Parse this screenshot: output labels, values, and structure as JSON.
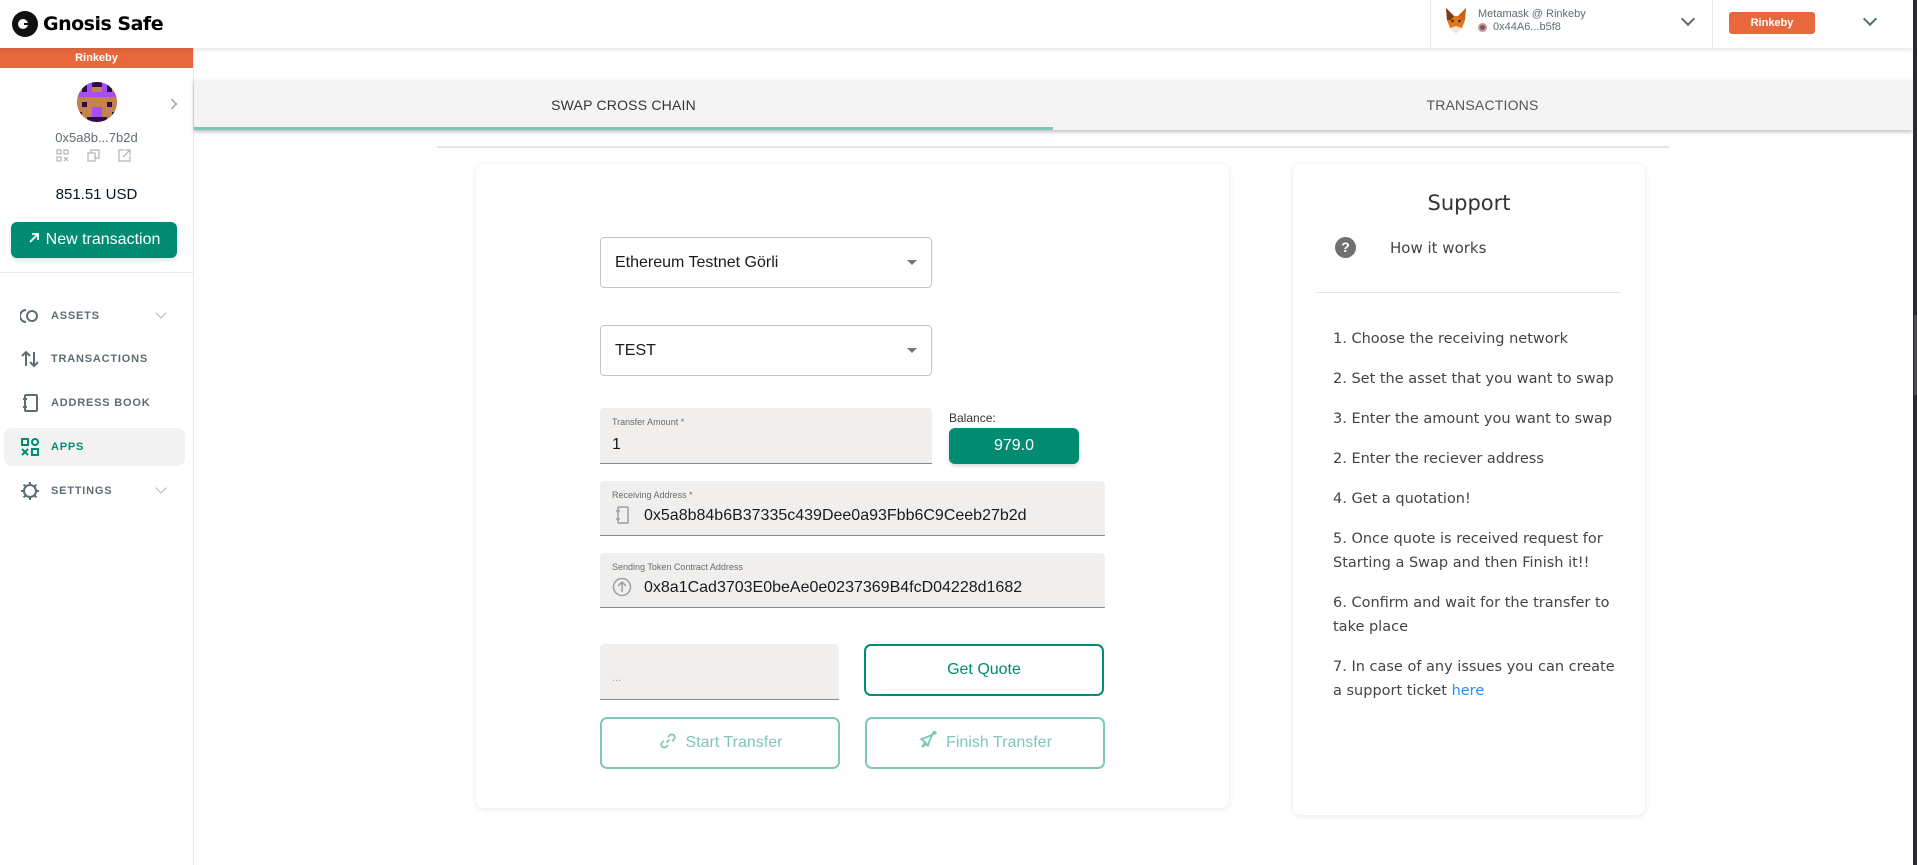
{
  "header": {
    "logo_text": "Gnosis Safe",
    "wallet": {
      "provider_label": "Metamask @ Rinkeby",
      "address": "0x44A6...b5f8",
      "icon": "metamask-fox-icon"
    },
    "network_badge": "Rinkeby"
  },
  "sidebar": {
    "network_bar": "Rinkeby",
    "safe_address": "0x5a8b...7b2d",
    "address_actions": [
      "qr-code-icon",
      "copy-icon",
      "external-link-icon"
    ],
    "balance": "851.51 USD",
    "new_transaction_label": "New transaction",
    "items": [
      {
        "label": "ASSETS",
        "icon": "assets-icon",
        "expandable": true,
        "active": false
      },
      {
        "label": "TRANSACTIONS",
        "icon": "transactions-arrows-icon",
        "expandable": false,
        "active": false
      },
      {
        "label": "ADDRESS BOOK",
        "icon": "address-book-icon",
        "expandable": false,
        "active": false
      },
      {
        "label": "APPS",
        "icon": "apps-icon",
        "expandable": false,
        "active": true
      },
      {
        "label": "SETTINGS",
        "icon": "settings-gear-icon",
        "expandable": true,
        "active": false
      }
    ]
  },
  "tabs": [
    {
      "label": "SWAP CROSS CHAIN",
      "active": true
    },
    {
      "label": "TRANSACTIONS",
      "active": false
    }
  ],
  "form": {
    "network_select": "Ethereum Testnet Görli",
    "token_select": "TEST",
    "transfer_amount": {
      "label": "Transfer Amount *",
      "value": "1"
    },
    "balance_label": "Balance:",
    "balance_value": "979.0",
    "receiving_address": {
      "label": "Receiving Address *",
      "value": "0x5a8b84b6B37335c439Dee0a93Fbb6C9Ceeb27b2d"
    },
    "sending_token_address": {
      "label": "Sending Token Contract Address",
      "value": "0x8a1Cad3703E0beAe0e0237369B4fcD04228d1682"
    },
    "quote_field": {
      "placeholder": "..."
    },
    "get_quote_label": "Get Quote",
    "start_transfer_label": "Start Transfer",
    "finish_transfer_label": "Finish Transfer"
  },
  "support": {
    "title": "Support",
    "how_it_works": "How it works",
    "steps": [
      "1. Choose the receiving network",
      "2. Set the asset that you want to swap",
      "3. Enter the amount you want to swap",
      "2. Enter the reciever address",
      "4. Get a quotation!",
      "5. Once quote is received request for Starting a Swap and then Finish it!!",
      "6. Confirm and wait for the transfer to take place"
    ],
    "last_step_text": "7. In case of any issues you can create a support ticket ",
    "last_step_link": "here"
  },
  "colors": {
    "accent": "#008c73",
    "accent_disabled": "#80c6b9",
    "network": "#e8673c",
    "link": "#1e90ff"
  }
}
